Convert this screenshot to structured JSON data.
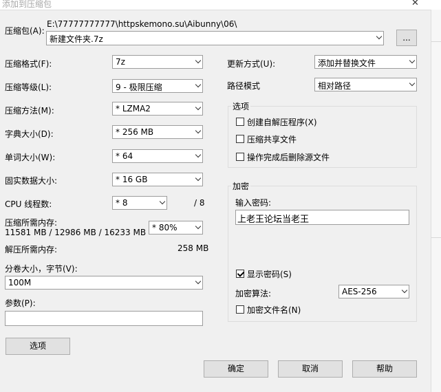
{
  "window": {
    "title": "添加到压缩包"
  },
  "archive": {
    "label": "压缩包(A):",
    "path": "E:\\77777777777\\httpskemono.su\\Aibunny\\06\\",
    "name": "新建文件夹.7z",
    "browse": "..."
  },
  "left": {
    "format": {
      "label": "压缩格式(F):",
      "value": "7z"
    },
    "level": {
      "label": "压缩等级(L):",
      "value": "9 - 极限压缩"
    },
    "method": {
      "label": "压缩方法(M):",
      "value": "* LZMA2"
    },
    "dict": {
      "label": "字典大小(D):",
      "value": "* 256 MB"
    },
    "word": {
      "label": "单词大小(W):",
      "value": "* 64"
    },
    "solid": {
      "label": "固实数据大小:",
      "value": "* 16 GB"
    },
    "threads": {
      "label": "CPU 线程数:",
      "value": "* 8",
      "max": "/ 8"
    },
    "mem_comp": {
      "label": "压缩所需内存:",
      "detail": "11581 MB / 12986 MB / 16233 MB",
      "value": "* 80%"
    },
    "mem_decomp": {
      "label": "解压所需内存:",
      "value": "258 MB"
    },
    "volume": {
      "label": "分卷大小，字节(V):",
      "value": "100M"
    },
    "params": {
      "label": "参数(P):",
      "value": ""
    },
    "options_button": "选项"
  },
  "right": {
    "update": {
      "label": "更新方式(U):",
      "value": "添加并替换文件"
    },
    "pathmode": {
      "label": "路径模式",
      "value": "相对路径"
    },
    "options": {
      "title": "选项",
      "items": [
        {
          "label": "创建自解压程序(X)",
          "checked": false
        },
        {
          "label": "压缩共享文件",
          "checked": false
        },
        {
          "label": "操作完成后删除源文件",
          "checked": false
        }
      ]
    },
    "encryption": {
      "title": "加密",
      "password_label": "输入密码:",
      "password": "上老王论坛当老王",
      "show_password": {
        "label": "显示密码(S)",
        "checked": true
      },
      "method_label": "加密算法:",
      "method": "AES-256",
      "encrypt_names": {
        "label": "加密文件名(N)",
        "checked": false
      }
    }
  },
  "buttons": {
    "ok": "确定",
    "cancel": "取消",
    "help": "帮助"
  }
}
